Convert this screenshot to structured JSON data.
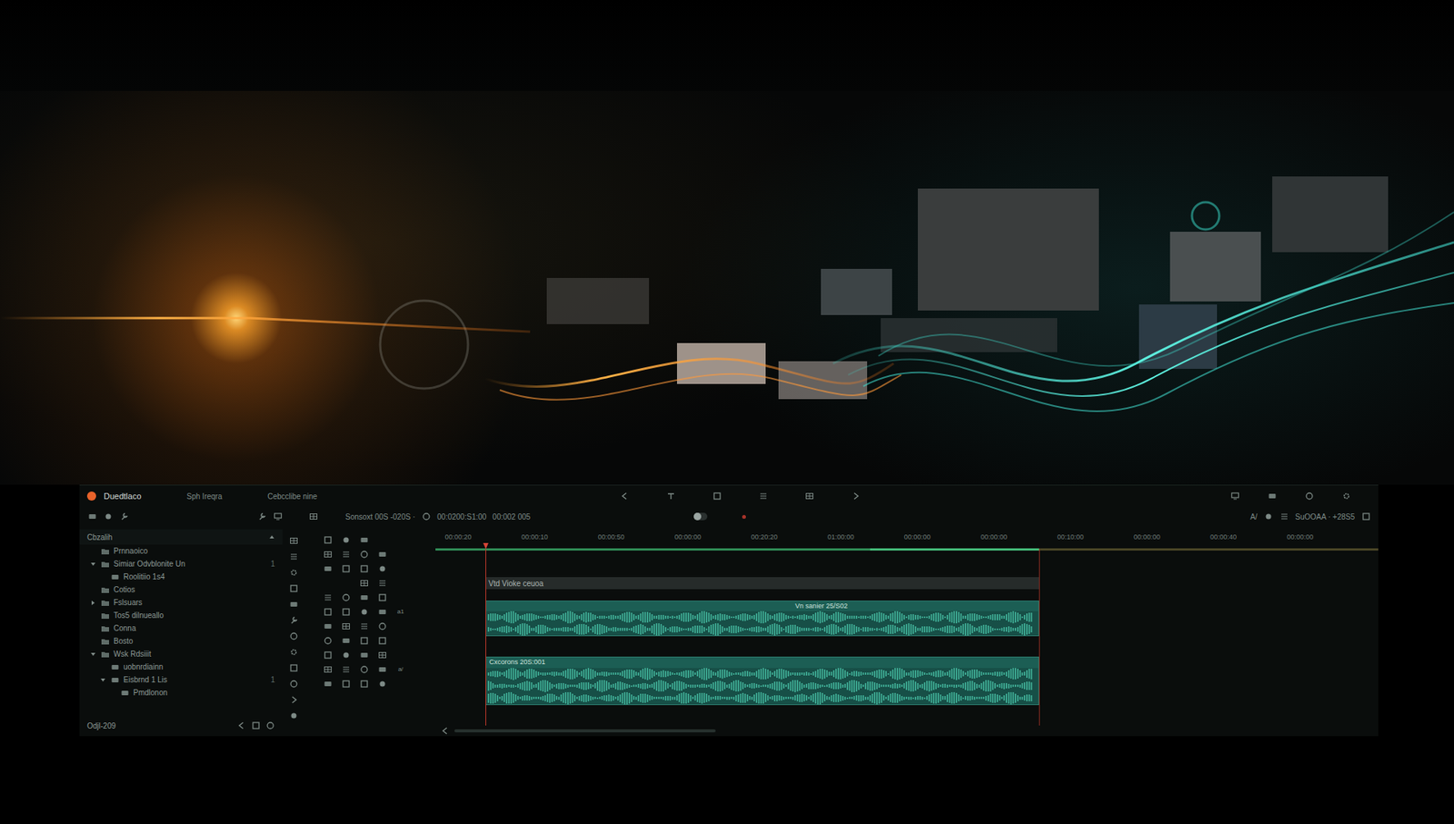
{
  "topbar": {
    "title": "Duedtlaco",
    "menus": [
      "Sph Ireqra",
      "Cebcclibe nine"
    ]
  },
  "toolbar": {
    "timecodes": [
      "Sonsoxt 00S -020S ·",
      "00:0200:S1:00",
      "00:002 005"
    ],
    "switch_on": false,
    "right": [
      "A/",
      "SuOOAA · +28S5"
    ]
  },
  "browser": {
    "header": "Cbzalih",
    "items": [
      {
        "label": "Prnnaoico"
      },
      {
        "label": "Simiar Odvblonite Un",
        "expanded": true,
        "count": "1",
        "children": [
          {
            "label": "Roolitiio 1s4"
          }
        ]
      },
      {
        "label": "Cotios"
      },
      {
        "label": "Fslsuars",
        "expanded": false
      },
      {
        "label": "Tos5 dilnueallo"
      },
      {
        "label": "Conna"
      },
      {
        "label": "Bosto"
      },
      {
        "label": "Wsk Rdsiiit",
        "expanded": true,
        "children": [
          {
            "label": "uobnrdiainn"
          },
          {
            "label": "Eisbrnd 1 Lis",
            "expanded": true,
            "count": "1",
            "children": [
              {
                "label": "Pmdlonon"
              }
            ]
          }
        ]
      }
    ],
    "footer": "Odjl-209"
  },
  "tools": {
    "tags": [
      "a1",
      "a/"
    ]
  },
  "timeline": {
    "ticks": [
      "00:00:20",
      "00:00:10",
      "00:00:50",
      "00:00:00",
      "00:20:20",
      "01:00:00",
      "00:00:00",
      "00:00:00",
      "00:10:00",
      "00:00:00",
      "00:00:40",
      "00:00:00"
    ],
    "tracks": [
      {
        "header": "Vtd Vioke ceuoa",
        "clip": "Vn sanier 25/S02"
      },
      {
        "clip": "Cxcorons 20S:001"
      }
    ]
  }
}
